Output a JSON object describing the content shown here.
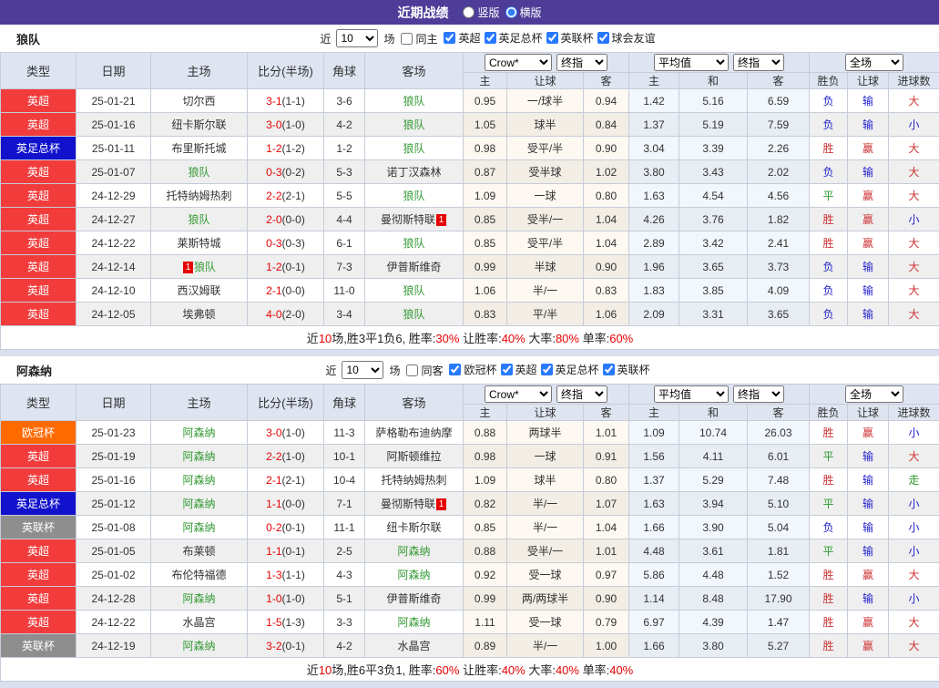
{
  "topbar": {
    "title": "近期战绩",
    "vertical_label": "竖版",
    "horizontal_label": "横版"
  },
  "table_header": {
    "static": [
      "类型",
      "日期",
      "主场",
      "比分(半场)",
      "角球",
      "客场"
    ],
    "sub": [
      "主",
      "让球",
      "客",
      "主",
      "和",
      "客",
      "胜负",
      "让球",
      "进球数"
    ],
    "selects": {
      "crow": "Crow*",
      "final1": "终指",
      "avg": "平均值",
      "final2": "终指",
      "full": "全场"
    }
  },
  "colors": {
    "league": {
      "英超": "#F23C3C",
      "英足总杯": "#1212CD",
      "欧冠杯": "#FF6A00",
      "英联杯": "#8E8E8E"
    },
    "topbar": "#4E3C99",
    "tracked_team": "#339933",
    "score": "#E60000",
    "win": "#CC3333",
    "lose": "#2222CC",
    "draw": "#2E9B2E"
  },
  "sections": [
    {
      "team": "狼队",
      "filter": {
        "near": "近",
        "count": "10",
        "unit": "场",
        "same": "同主",
        "same_checked": false,
        "leagues": [
          "英超",
          "英足总杯",
          "英联杯",
          "球会友谊"
        ]
      },
      "rows": [
        {
          "type": "英超",
          "date": "25-01-21",
          "home": "切尔西",
          "home_t": false,
          "home_card": "",
          "score": "3-1",
          "half": "(1-1)",
          "corner": "3-6",
          "away": "狼队",
          "away_t": true,
          "away_card": "",
          "o1": "0.95",
          "o2": "一/球半",
          "o3": "0.94",
          "a1": "1.42",
          "a2": "5.16",
          "a3": "6.59",
          "r1": "负",
          "r2": "输",
          "r3": "大"
        },
        {
          "type": "英超",
          "date": "25-01-16",
          "home": "纽卡斯尔联",
          "home_t": false,
          "home_card": "",
          "score": "3-0",
          "half": "(1-0)",
          "corner": "4-2",
          "away": "狼队",
          "away_t": true,
          "away_card": "",
          "o1": "1.05",
          "o2": "球半",
          "o3": "0.84",
          "a1": "1.37",
          "a2": "5.19",
          "a3": "7.59",
          "r1": "负",
          "r2": "输",
          "r3": "小"
        },
        {
          "type": "英足总杯",
          "date": "25-01-11",
          "home": "布里斯托城",
          "home_t": false,
          "home_card": "",
          "score": "1-2",
          "half": "(1-2)",
          "corner": "1-2",
          "away": "狼队",
          "away_t": true,
          "away_card": "",
          "o1": "0.98",
          "o2": "受平/半",
          "o3": "0.90",
          "a1": "3.04",
          "a2": "3.39",
          "a3": "2.26",
          "r1": "胜",
          "r2": "赢",
          "r3": "大"
        },
        {
          "type": "英超",
          "date": "25-01-07",
          "home": "狼队",
          "home_t": true,
          "home_card": "",
          "score": "0-3",
          "half": "(0-2)",
          "corner": "5-3",
          "away": "诺丁汉森林",
          "away_t": false,
          "away_card": "",
          "o1": "0.87",
          "o2": "受半球",
          "o3": "1.02",
          "a1": "3.80",
          "a2": "3.43",
          "a3": "2.02",
          "r1": "负",
          "r2": "输",
          "r3": "大"
        },
        {
          "type": "英超",
          "date": "24-12-29",
          "home": "托特纳姆热刺",
          "home_t": false,
          "home_card": "",
          "score": "2-2",
          "half": "(2-1)",
          "corner": "5-5",
          "away": "狼队",
          "away_t": true,
          "away_card": "",
          "o1": "1.09",
          "o2": "一球",
          "o3": "0.80",
          "a1": "1.63",
          "a2": "4.54",
          "a3": "4.56",
          "r1": "平",
          "r2": "赢",
          "r3": "大"
        },
        {
          "type": "英超",
          "date": "24-12-27",
          "home": "狼队",
          "home_t": true,
          "home_card": "",
          "score": "2-0",
          "half": "(0-0)",
          "corner": "4-4",
          "away": "曼彻斯特联",
          "away_t": false,
          "away_card": "1",
          "o1": "0.85",
          "o2": "受半/一",
          "o3": "1.04",
          "a1": "4.26",
          "a2": "3.76",
          "a3": "1.82",
          "r1": "胜",
          "r2": "赢",
          "r3": "小"
        },
        {
          "type": "英超",
          "date": "24-12-22",
          "home": "莱斯特城",
          "home_t": false,
          "home_card": "",
          "score": "0-3",
          "half": "(0-3)",
          "corner": "6-1",
          "away": "狼队",
          "away_t": true,
          "away_card": "",
          "o1": "0.85",
          "o2": "受平/半",
          "o3": "1.04",
          "a1": "2.89",
          "a2": "3.42",
          "a3": "2.41",
          "r1": "胜",
          "r2": "赢",
          "r3": "大"
        },
        {
          "type": "英超",
          "date": "24-12-14",
          "home": "狼队",
          "home_t": true,
          "home_card": "1",
          "score": "1-2",
          "half": "(0-1)",
          "corner": "7-3",
          "away": "伊普斯维奇",
          "away_t": false,
          "away_card": "",
          "o1": "0.99",
          "o2": "半球",
          "o3": "0.90",
          "a1": "1.96",
          "a2": "3.65",
          "a3": "3.73",
          "r1": "负",
          "r2": "输",
          "r3": "大"
        },
        {
          "type": "英超",
          "date": "24-12-10",
          "home": "西汉姆联",
          "home_t": false,
          "home_card": "",
          "score": "2-1",
          "half": "(0-0)",
          "corner": "11-0",
          "away": "狼队",
          "away_t": true,
          "away_card": "",
          "o1": "1.06",
          "o2": "半/一",
          "o3": "0.83",
          "a1": "1.83",
          "a2": "3.85",
          "a3": "4.09",
          "r1": "负",
          "r2": "输",
          "r3": "大"
        },
        {
          "type": "英超",
          "date": "24-12-05",
          "home": "埃弗顿",
          "home_t": false,
          "home_card": "",
          "score": "4-0",
          "half": "(2-0)",
          "corner": "3-4",
          "away": "狼队",
          "away_t": true,
          "away_card": "",
          "o1": "0.83",
          "o2": "平/半",
          "o3": "1.06",
          "a1": "2.09",
          "a2": "3.31",
          "a3": "3.65",
          "r1": "负",
          "r2": "输",
          "r3": "大"
        }
      ],
      "summary": [
        [
          "近",
          "k"
        ],
        [
          "10",
          "r"
        ],
        [
          "场,胜3平1负6, 胜率:",
          "k"
        ],
        [
          "30%",
          "r"
        ],
        [
          " 让胜率:",
          "k"
        ],
        [
          "40%",
          "r"
        ],
        [
          " 大率:",
          "k"
        ],
        [
          "80%",
          "r"
        ],
        [
          " 单率:",
          "k"
        ],
        [
          "60%",
          "r"
        ]
      ]
    },
    {
      "team": "阿森纳",
      "filter": {
        "near": "近",
        "count": "10",
        "unit": "场",
        "same": "同客",
        "same_checked": false,
        "leagues": [
          "欧冠杯",
          "英超",
          "英足总杯",
          "英联杯"
        ]
      },
      "rows": [
        {
          "type": "欧冠杯",
          "date": "25-01-23",
          "home": "阿森纳",
          "home_t": true,
          "home_card": "",
          "score": "3-0",
          "half": "(1-0)",
          "corner": "11-3",
          "away": "萨格勒布迪纳摩",
          "away_t": false,
          "away_card": "",
          "o1": "0.88",
          "o2": "两球半",
          "o3": "1.01",
          "a1": "1.09",
          "a2": "10.74",
          "a3": "26.03",
          "r1": "胜",
          "r2": "赢",
          "r3": "小"
        },
        {
          "type": "英超",
          "date": "25-01-19",
          "home": "阿森纳",
          "home_t": true,
          "home_card": "",
          "score": "2-2",
          "half": "(1-0)",
          "corner": "10-1",
          "away": "阿斯顿维拉",
          "away_t": false,
          "away_card": "",
          "o1": "0.98",
          "o2": "一球",
          "o3": "0.91",
          "a1": "1.56",
          "a2": "4.11",
          "a3": "6.01",
          "r1": "平",
          "r2": "输",
          "r3": "大"
        },
        {
          "type": "英超",
          "date": "25-01-16",
          "home": "阿森纳",
          "home_t": true,
          "home_card": "",
          "score": "2-1",
          "half": "(2-1)",
          "corner": "10-4",
          "away": "托特纳姆热刺",
          "away_t": false,
          "away_card": "",
          "o1": "1.09",
          "o2": "球半",
          "o3": "0.80",
          "a1": "1.37",
          "a2": "5.29",
          "a3": "7.48",
          "r1": "胜",
          "r2": "输",
          "r3": "走"
        },
        {
          "type": "英足总杯",
          "date": "25-01-12",
          "home": "阿森纳",
          "home_t": true,
          "home_card": "",
          "score": "1-1",
          "half": "(0-0)",
          "corner": "7-1",
          "away": "曼彻斯特联",
          "away_t": false,
          "away_card": "1",
          "o1": "0.82",
          "o2": "半/一",
          "o3": "1.07",
          "a1": "1.63",
          "a2": "3.94",
          "a3": "5.10",
          "r1": "平",
          "r2": "输",
          "r3": "小"
        },
        {
          "type": "英联杯",
          "date": "25-01-08",
          "home": "阿森纳",
          "home_t": true,
          "home_card": "",
          "score": "0-2",
          "half": "(0-1)",
          "corner": "11-1",
          "away": "纽卡斯尔联",
          "away_t": false,
          "away_card": "",
          "o1": "0.85",
          "o2": "半/一",
          "o3": "1.04",
          "a1": "1.66",
          "a2": "3.90",
          "a3": "5.04",
          "r1": "负",
          "r2": "输",
          "r3": "小"
        },
        {
          "type": "英超",
          "date": "25-01-05",
          "home": "布莱顿",
          "home_t": false,
          "home_card": "",
          "score": "1-1",
          "half": "(0-1)",
          "corner": "2-5",
          "away": "阿森纳",
          "away_t": true,
          "away_card": "",
          "o1": "0.88",
          "o2": "受半/一",
          "o3": "1.01",
          "a1": "4.48",
          "a2": "3.61",
          "a3": "1.81",
          "r1": "平",
          "r2": "输",
          "r3": "小"
        },
        {
          "type": "英超",
          "date": "25-01-02",
          "home": "布伦特福德",
          "home_t": false,
          "home_card": "",
          "score": "1-3",
          "half": "(1-1)",
          "corner": "4-3",
          "away": "阿森纳",
          "away_t": true,
          "away_card": "",
          "o1": "0.92",
          "o2": "受一球",
          "o3": "0.97",
          "a1": "5.86",
          "a2": "4.48",
          "a3": "1.52",
          "r1": "胜",
          "r2": "赢",
          "r3": "大"
        },
        {
          "type": "英超",
          "date": "24-12-28",
          "home": "阿森纳",
          "home_t": true,
          "home_card": "",
          "score": "1-0",
          "half": "(1-0)",
          "corner": "5-1",
          "away": "伊普斯维奇",
          "away_t": false,
          "away_card": "",
          "o1": "0.99",
          "o2": "两/两球半",
          "o3": "0.90",
          "a1": "1.14",
          "a2": "8.48",
          "a3": "17.90",
          "r1": "胜",
          "r2": "输",
          "r3": "小"
        },
        {
          "type": "英超",
          "date": "24-12-22",
          "home": "水晶宫",
          "home_t": false,
          "home_card": "",
          "score": "1-5",
          "half": "(1-3)",
          "corner": "3-3",
          "away": "阿森纳",
          "away_t": true,
          "away_card": "",
          "o1": "1.11",
          "o2": "受一球",
          "o3": "0.79",
          "a1": "6.97",
          "a2": "4.39",
          "a3": "1.47",
          "r1": "胜",
          "r2": "赢",
          "r3": "大"
        },
        {
          "type": "英联杯",
          "date": "24-12-19",
          "home": "阿森纳",
          "home_t": true,
          "home_card": "",
          "score": "3-2",
          "half": "(0-1)",
          "corner": "4-2",
          "away": "水晶宫",
          "away_t": false,
          "away_card": "",
          "o1": "0.89",
          "o2": "半/一",
          "o3": "1.00",
          "a1": "1.66",
          "a2": "3.80",
          "a3": "5.27",
          "r1": "胜",
          "r2": "赢",
          "r3": "大"
        }
      ],
      "summary": [
        [
          "近",
          "k"
        ],
        [
          "10",
          "r"
        ],
        [
          "场,胜6平3负1, 胜率:",
          "k"
        ],
        [
          "60%",
          "r"
        ],
        [
          " 让胜率:",
          "k"
        ],
        [
          "40%",
          "r"
        ],
        [
          " 大率:",
          "k"
        ],
        [
          "40%",
          "r"
        ],
        [
          " 单率:",
          "k"
        ],
        [
          "40%",
          "r"
        ]
      ]
    }
  ]
}
